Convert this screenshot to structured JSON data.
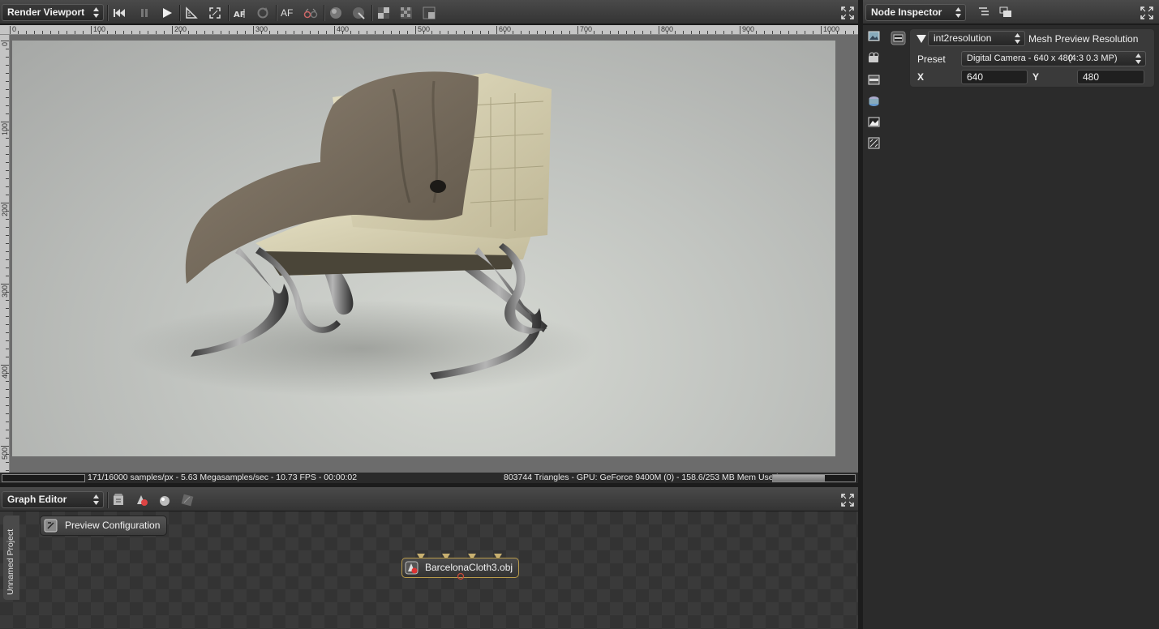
{
  "viewport": {
    "title": "Render Viewport",
    "ruler_top": [
      "0",
      "100",
      "200",
      "300",
      "400",
      "500",
      "600",
      "700",
      "800",
      "900",
      "1000"
    ],
    "ruler_left": [
      "0",
      "100",
      "200",
      "300",
      "400",
      "500"
    ],
    "toolbar": {
      "af_text": "AF"
    },
    "status": {
      "samples": "171/16000 samples/px - 5.63 Megasamples/sec - 10.73 FPS - 00:00:02",
      "gpu": "803744 Triangles - GPU: GeForce 9400M (0) - 158.6/253 MB Mem Used",
      "memory_fraction": 0.63
    }
  },
  "inspector": {
    "title": "Node Inspector",
    "node_type": "int2resolution",
    "node_name": "Mesh Preview Resolution",
    "preset_label": "Preset",
    "preset_value": "Digital Camera - 640 x 480",
    "preset_detail": "(4:3 0.3  MP)",
    "x_label": "X",
    "x_value": "640",
    "y_label": "Y",
    "y_value": "480"
  },
  "graph": {
    "title": "Graph Editor",
    "project_tab": "Unnamed Project",
    "nodes": {
      "preview": "Preview Configuration",
      "mesh": "BarcelonaCloth3.obj"
    }
  },
  "colors": {
    "accent_node_border": "#b89a4a",
    "panel_bg": "#2b2b2b"
  }
}
